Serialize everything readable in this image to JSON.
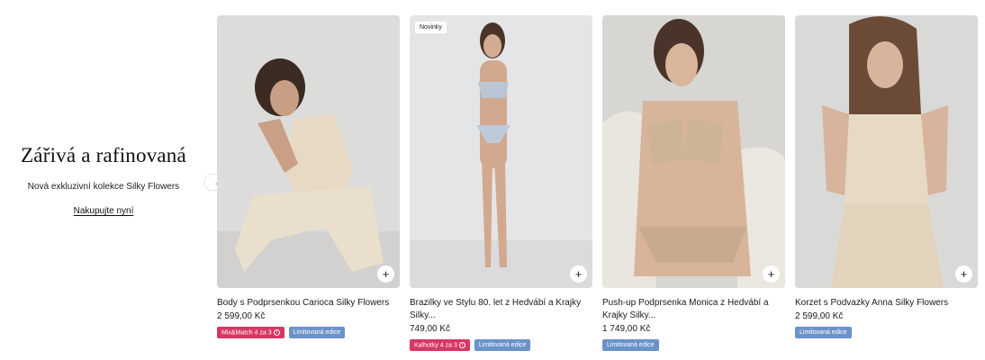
{
  "promo": {
    "title": "Zářivá a rafinovaná",
    "subtitle": "Nová exkluzivní kolekce Silky Flowers",
    "cta": "Nakupujte nyní"
  },
  "carousel": {
    "prev_icon": "chevron-left-icon"
  },
  "products": [
    {
      "name": "Body s Podprsenkou Carioca Silky Flowers",
      "price": "2 599,00 Kč",
      "badge_new": "",
      "badges": [
        "Mix&Match 4 za 3",
        "Limitovaná edice"
      ]
    },
    {
      "name": "Brazilky ve Stylu 80. let z Hedvábí a Krajky Silky...",
      "price": "749,00 Kč",
      "badge_new": "Novinky",
      "badges": [
        "Kalhotky 4 za 3",
        "Limitovaná edice"
      ]
    },
    {
      "name": "Push-up Podprsenka Monica z Hedvábí a Krajky Silky...",
      "price": "1 749,00 Kč",
      "badge_new": "",
      "badges": [
        "Limitovaná edice"
      ]
    },
    {
      "name": "Korzet s Podvazky Anna Silky Flowers",
      "price": "2 599,00 Kč",
      "badge_new": "",
      "badges": [
        "Limitovaná edice"
      ]
    }
  ],
  "colors": {
    "promo_badge": "#d63763",
    "limited_badge": "#6b93c9"
  }
}
